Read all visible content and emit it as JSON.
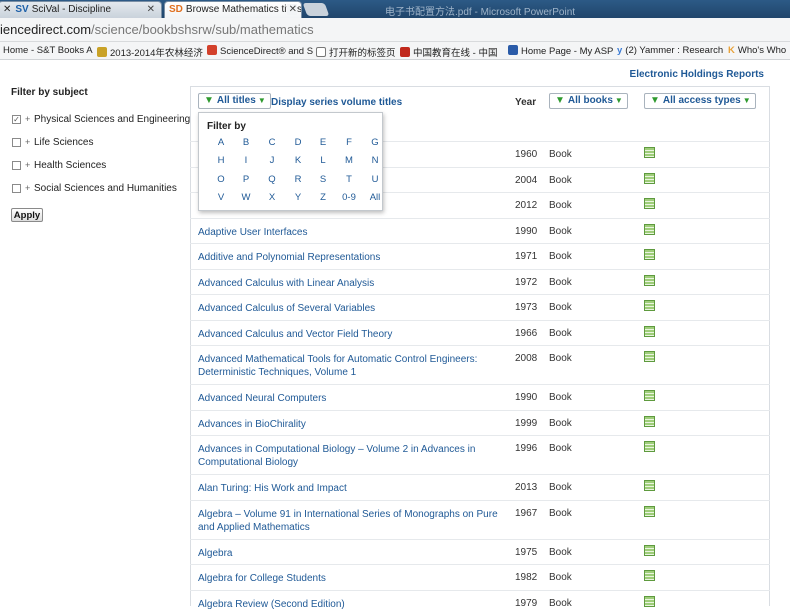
{
  "browser": {
    "tabs": [
      {
        "label": "SciVal - Discipline",
        "favicon": "SV"
      },
      {
        "label": "Browse Mathematics titles",
        "favicon": "SD"
      }
    ],
    "title_bar_text": "电子书配置方法.pdf - Microsoft PowerPoint",
    "url_prefix": "iencedirect.com",
    "url_path": "/science/bookbshsrw/sub/mathematics",
    "bookmarks": [
      {
        "label": "Home - S&T Books A",
        "color": "#e8842a"
      },
      {
        "label": "2013-2014年农林经济",
        "color": "#c9a227"
      },
      {
        "label": "ScienceDirect® and S",
        "color": "#d3402b"
      },
      {
        "label": "打开新的标签页",
        "color": "#ffffff"
      },
      {
        "label": "中国教育在线 - 中国",
        "color": "#c0281c"
      },
      {
        "label": "Home Page - My ASP",
        "color": "#2a5ba8"
      },
      {
        "label": "(2) Yammer : Research",
        "color": "#3a7bd5"
      },
      {
        "label": "Who's Who",
        "color": "#e8a23a"
      }
    ]
  },
  "page": {
    "electronic_holdings": "Electronic Holdings Reports",
    "sidebar": {
      "title": "Filter by subject",
      "subjects": [
        {
          "label": "Physical Sciences and Engineering",
          "checked": true
        },
        {
          "label": "Life Sciences",
          "checked": false
        },
        {
          "label": "Health Sciences",
          "checked": false
        },
        {
          "label": "Social Sciences and Humanities",
          "checked": false
        }
      ],
      "apply_label": "Apply"
    },
    "toolbar": {
      "all_titles": "All titles",
      "display_series": "Display series volume titles",
      "year_header": "Year",
      "all_books": "All books",
      "all_access": "All access types"
    },
    "dropdown": {
      "title": "Filter by",
      "letters": [
        "A",
        "B",
        "C",
        "D",
        "E",
        "F",
        "G",
        "H",
        "I",
        "J",
        "K",
        "L",
        "M",
        "N",
        "O",
        "P",
        "Q",
        "R",
        "S",
        "T",
        "U",
        "V",
        "W",
        "X",
        "Y",
        "Z",
        "0-9",
        "All"
      ]
    },
    "rows": [
      {
        "title": "",
        "year": "1960",
        "type": "Book",
        "lines": 1
      },
      {
        "title": "",
        "year": "2004",
        "type": "Book",
        "lines": 1
      },
      {
        "title": "",
        "year": "2012",
        "type": "Book",
        "lines": 1
      },
      {
        "title": "Adaptive User Interfaces",
        "year": "1990",
        "type": "Book",
        "lines": 1
      },
      {
        "title": "Additive and Polynomial Representations",
        "year": "1971",
        "type": "Book",
        "lines": 1
      },
      {
        "title": "Advanced Calculus with Linear Analysis",
        "year": "1972",
        "type": "Book",
        "lines": 1
      },
      {
        "title": "Advanced Calculus of Several Variables",
        "year": "1973",
        "type": "Book",
        "lines": 1
      },
      {
        "title": "Advanced Calculus and Vector Field Theory",
        "year": "1966",
        "type": "Book",
        "lines": 1
      },
      {
        "title": "Advanced Mathematical Tools for Automatic Control Engineers: Deterministic Techniques, Volume 1",
        "year": "2008",
        "type": "Book",
        "lines": 2
      },
      {
        "title": "Advanced Neural Computers",
        "year": "1990",
        "type": "Book",
        "lines": 1
      },
      {
        "title": "Advances in BioChirality",
        "year": "1999",
        "type": "Book",
        "lines": 1
      },
      {
        "title": "Advances in Computational Biology – Volume 2 in Advances in Computational Biology",
        "year": "1996",
        "type": "Book",
        "lines": 2
      },
      {
        "title": "Alan Turing: His Work and Impact",
        "year": "2013",
        "type": "Book",
        "lines": 1
      },
      {
        "title": "Algebra – Volume 91 in International Series of Monographs on Pure and Applied Mathematics",
        "year": "1967",
        "type": "Book",
        "lines": 2
      },
      {
        "title": "Algebra",
        "year": "1975",
        "type": "Book",
        "lines": 1
      },
      {
        "title": "Algebra for College Students",
        "year": "1982",
        "type": "Book",
        "lines": 1
      },
      {
        "title": "Algebra Review (Second Edition)",
        "year": "1979",
        "type": "Book",
        "lines": 1
      }
    ]
  }
}
